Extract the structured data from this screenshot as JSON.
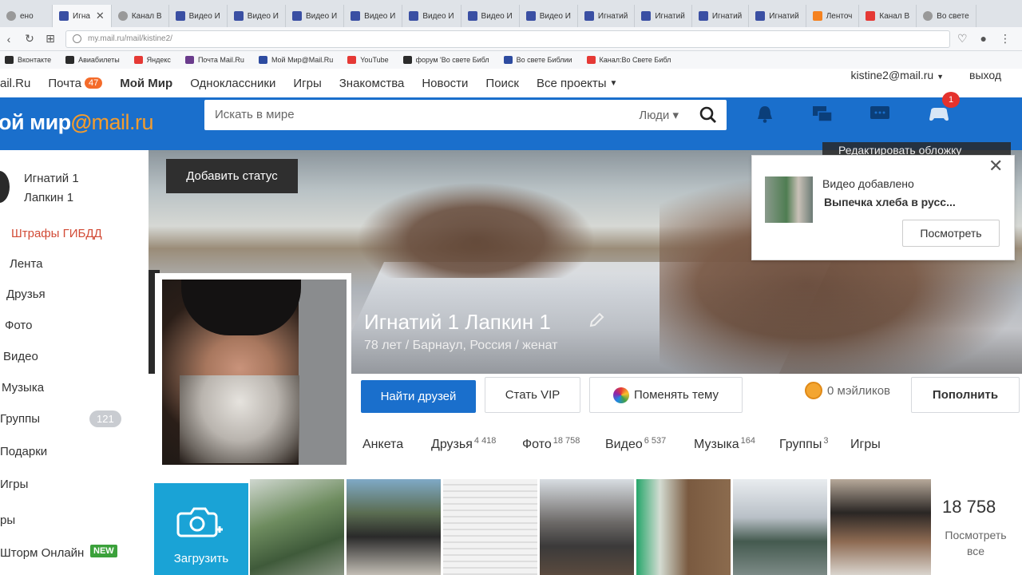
{
  "browser": {
    "tabs": [
      {
        "label": "ено",
        "icon": "page-icon"
      },
      {
        "label": "Игна",
        "icon": "mail-icon",
        "active": true
      },
      {
        "label": "Канал В",
        "icon": "globe-icon"
      },
      {
        "label": "Видео И",
        "icon": "mail-icon"
      },
      {
        "label": "Видео И",
        "icon": "mail-icon"
      },
      {
        "label": "Видео И",
        "icon": "mail-icon"
      },
      {
        "label": "Видео И",
        "icon": "mail-icon"
      },
      {
        "label": "Видео И",
        "icon": "mail-icon"
      },
      {
        "label": "Видео И",
        "icon": "mail-icon"
      },
      {
        "label": "Видео И",
        "icon": "mail-icon"
      },
      {
        "label": "Игнатий",
        "icon": "mail-icon"
      },
      {
        "label": "Игнатий",
        "icon": "mail-icon"
      },
      {
        "label": "Игнатий",
        "icon": "mail-icon"
      },
      {
        "label": "Игнатий",
        "icon": "mail-icon"
      },
      {
        "label": "Ленточ",
        "icon": "ok-icon"
      },
      {
        "label": "Канал В",
        "icon": "youtube-icon"
      },
      {
        "label": "Во свете",
        "icon": "globe-icon"
      }
    ],
    "url": "my.mail.ru/mail/kistine2/",
    "bookmarks": [
      {
        "label": "Вконтакте",
        "icon": "vk-icon"
      },
      {
        "label": "Авиабилеты",
        "icon": "plane-icon"
      },
      {
        "label": "Яндекс",
        "icon": "yandex-icon"
      },
      {
        "label": "Почта Mail.Ru",
        "icon": "mail-icon"
      },
      {
        "label": "Мой Мир@Mail.Ru",
        "icon": "myworld-icon"
      },
      {
        "label": "YouTube",
        "icon": "youtube-icon"
      },
      {
        "label": "форум 'Во свете Библ",
        "icon": "forum-icon"
      },
      {
        "label": "Во свете Библии",
        "icon": "bible-icon"
      },
      {
        "label": "Канал:Во Свете Библ",
        "icon": "youtube-icon"
      }
    ]
  },
  "portal": {
    "items": [
      "ail.Ru",
      "Почта",
      "Мой Мир",
      "Одноклассники",
      "Игры",
      "Знакомства",
      "Новости",
      "Поиск",
      "Все проекты"
    ],
    "mail_count": "47",
    "user_email": "kistine2@mail.ru",
    "logout": "выход"
  },
  "header": {
    "logo_main": "ой мир",
    "logo_at": "@",
    "logo_domain": "mail.ru",
    "search_placeholder": "Искать в мире",
    "search_scope": "Люди",
    "games_badge": "1"
  },
  "sidebar": {
    "name_line1": "Игнатий 1",
    "name_line2": "Лапкин 1",
    "items": [
      "Штрафы ГИБДД",
      "Лента",
      "Друзья",
      "Фото",
      "Видео",
      "Музыка",
      "Группы",
      "Подарки",
      "Игры",
      "ры",
      "Шторм Онлайн"
    ],
    "groups_count": "121",
    "new_badge": "NEW"
  },
  "profile": {
    "add_status": "Добавить статус",
    "edit_cover": "Редактировать обложку",
    "name": "Игнатий 1 Лапкин 1",
    "meta": "78 лет / Барнаул, Россия / женат",
    "find_friends": "Найти друзей",
    "become_vip": "Стать VIP",
    "change_theme": "Поменять тему",
    "mailiki": "0 мэйликов",
    "topup": "Пополнить"
  },
  "tabs": [
    {
      "label": "Анкета",
      "count": ""
    },
    {
      "label": "Друзья",
      "count": "4 418"
    },
    {
      "label": "Фото",
      "count": "18 758"
    },
    {
      "label": "Видео",
      "count": "6 537"
    },
    {
      "label": "Музыка",
      "count": "164"
    },
    {
      "label": "Группы",
      "count": "3"
    },
    {
      "label": "Игры",
      "count": ""
    }
  ],
  "notification": {
    "title": "Видео добавлено",
    "body": "Выпечка хлеба в русс...",
    "button": "Посмотреть"
  },
  "photos": {
    "upload": "Загрузить",
    "total": "18 758",
    "see_all_line1": "Посмотреть",
    "see_all_line2": "все"
  },
  "colors": {
    "brand_blue": "#1a6fcc",
    "accent_orange": "#f39c2e",
    "upload_cyan": "#1aa3d6",
    "badge_red": "#e5322d"
  }
}
